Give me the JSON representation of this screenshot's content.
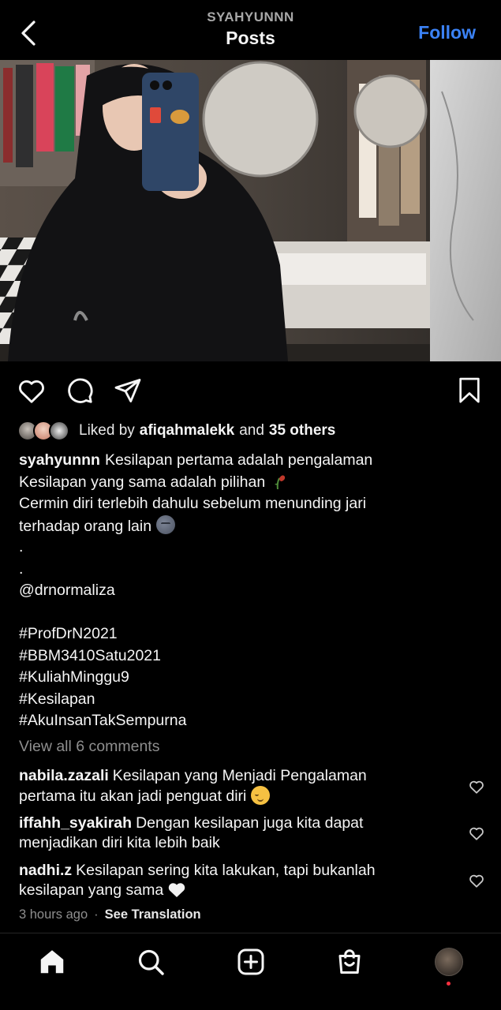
{
  "header": {
    "username": "SYAHYUNNN",
    "title": "Posts",
    "follow_label": "Follow"
  },
  "icons": {
    "back": "chevron-left-icon",
    "like": "heart-icon",
    "comment": "comment-icon",
    "share": "paper-plane-icon",
    "save": "bookmark-icon",
    "home": "home-icon",
    "search": "search-icon",
    "create": "plus-square-icon",
    "shop": "shopping-bag-icon"
  },
  "likes": {
    "prefix": "Liked by",
    "user": "afiqahmalekk",
    "connector": "and",
    "others": "35 others"
  },
  "caption": {
    "username": "syahyunnn",
    "lines": [
      "Kesilapan pertama adalah pengalaman",
      "Kesilapan yang sama adalah pilihan",
      "Cermin diri terlebih dahulu sebelum menunding jari",
      "terhadap orang lain",
      ".",
      ".",
      "@drnormaliza",
      "",
      "#ProfDrN2021",
      "#BBM3410Satu2021",
      "#KuliahMinggu9",
      "#Kesilapan",
      "#AkuInsanTakSempurna"
    ]
  },
  "view_all_comments": "View all 6 comments",
  "comments": [
    {
      "user": "nabila.zazali",
      "line1": "Kesilapan yang Menjadi Pengalaman",
      "line2": "pertama itu akan jadi penguat diri"
    },
    {
      "user": "iffahh_syakirah",
      "line1": "Dengan kesilapan juga kita dapat",
      "line2": "menjadikan diri kita lebih baik"
    },
    {
      "user": "nadhi.z",
      "line1": "Kesilapan sering kita lakukan, tapi bukanlah",
      "line2": "kesilapan yang sama"
    }
  ],
  "meta": {
    "time": "3 hours ago",
    "separator": "·",
    "see_translation": "See Translation"
  },
  "colors": {
    "background": "#000000",
    "follow": "#3b82f6",
    "muted": "#8e8e8e",
    "notification_dot": "#ff3040"
  }
}
